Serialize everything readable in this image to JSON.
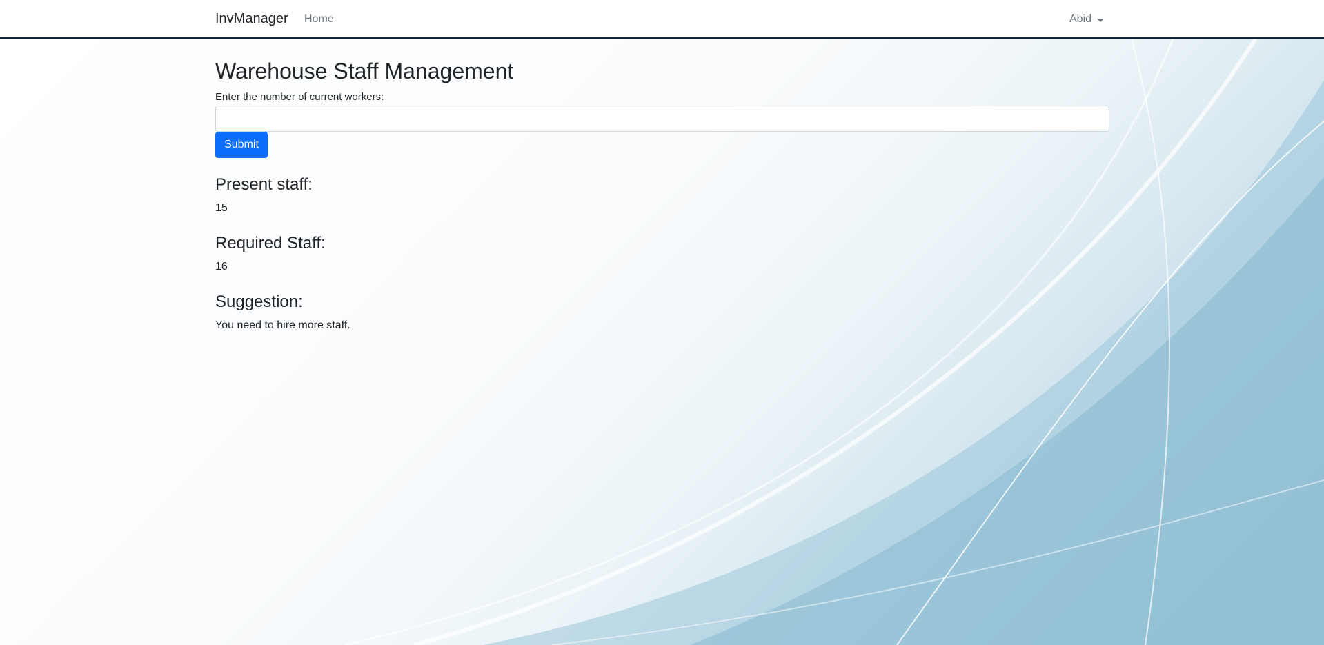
{
  "navbar": {
    "brand": "InvManager",
    "links": [
      {
        "label": "Home"
      }
    ],
    "user": {
      "name": "Abid"
    }
  },
  "main": {
    "title": "Warehouse Staff Management",
    "workers_field": {
      "label": "Enter the number of current workers:",
      "value": "",
      "placeholder": ""
    },
    "submit_label": "Submit",
    "present": {
      "heading": "Present staff:",
      "value": "15"
    },
    "required": {
      "heading": "Required Staff:",
      "value": "16"
    },
    "suggestion": {
      "heading": "Suggestion:",
      "text": "You need to hire more staff."
    }
  },
  "colors": {
    "primary_button": "#0d6efd",
    "navbar_border": "#0d2436",
    "background_accent": "#7fb3cc"
  }
}
